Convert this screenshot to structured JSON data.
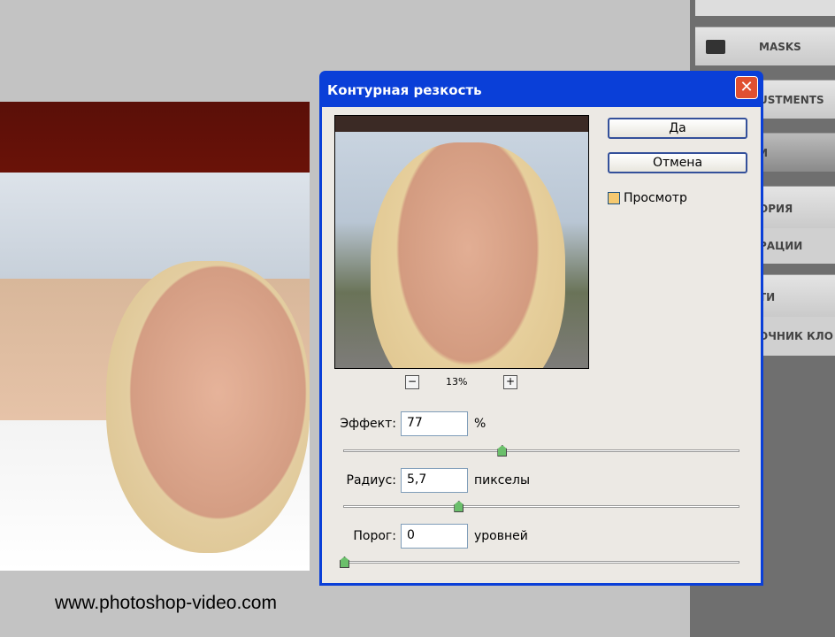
{
  "dialog": {
    "title": "Контурная резкость",
    "ok_label": "Да",
    "cancel_label": "Отмена",
    "preview_label": "Просмотр",
    "preview_checked": true,
    "zoom_level": "13%",
    "zoom_out": "−",
    "zoom_in": "+",
    "amount": {
      "label": "Эффект:",
      "value": "77",
      "unit": "%",
      "slider_percent": 40
    },
    "radius": {
      "label": "Радиус:",
      "value": "5,7",
      "unit": "пикселы",
      "slider_percent": 29
    },
    "threshold": {
      "label": "Порог:",
      "value": "0",
      "unit": "уровней",
      "slider_percent": 0
    },
    "close": "✕"
  },
  "panels": {
    "items": [
      "MASKS",
      "USTMENTS",
      "И",
      "ОРИЯ",
      "РАЦИИ",
      "ТИ",
      "ОЧНИК КЛО"
    ]
  },
  "watermark": "www.photoshop-video.com"
}
